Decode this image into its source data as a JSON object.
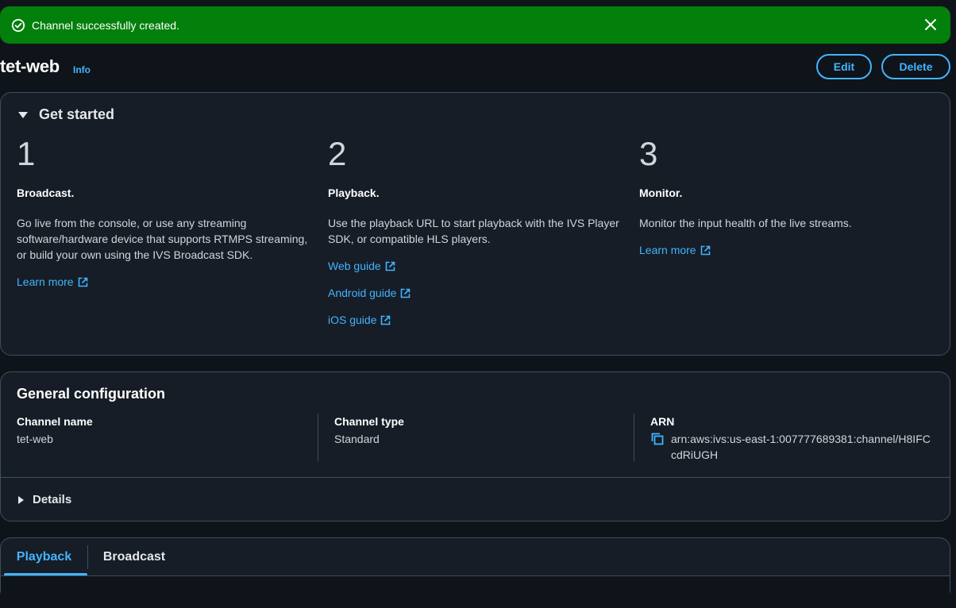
{
  "flash": {
    "message": "Channel successfully created.",
    "color": "#037f0c"
  },
  "header": {
    "title": "tet-web",
    "info": "Info",
    "edit": "Edit",
    "delete": "Delete"
  },
  "get_started": {
    "title": "Get started",
    "steps": [
      {
        "num": "1",
        "title": "Broadcast.",
        "desc": "Go live from the console, or use any streaming software/hardware device that supports RTMPS streaming, or build your own using the IVS Broadcast SDK.",
        "links": [
          "Learn more"
        ]
      },
      {
        "num": "2",
        "title": "Playback.",
        "desc": "Use the playback URL to start playback with the IVS Player SDK, or compatible HLS players.",
        "links": [
          "Web guide",
          "Android guide",
          "iOS guide"
        ]
      },
      {
        "num": "3",
        "title": "Monitor.",
        "desc": "Monitor the input health of the live streams.",
        "links": [
          "Learn more"
        ]
      }
    ]
  },
  "general_config": {
    "title": "General configuration",
    "channel_name_label": "Channel name",
    "channel_name": "tet-web",
    "channel_type_label": "Channel type",
    "channel_type": "Standard",
    "arn_label": "ARN",
    "arn": "arn:aws:ivs:us-east-1:007777689381:channel/H8IFCcdRiUGH",
    "details": "Details"
  },
  "tabs": [
    {
      "label": "Playback",
      "active": true
    },
    {
      "label": "Broadcast",
      "active": false
    }
  ],
  "colors": {
    "accent": "#42b4ff",
    "background": "#0f141a",
    "panel": "#161d26",
    "border": "#414d5c"
  }
}
